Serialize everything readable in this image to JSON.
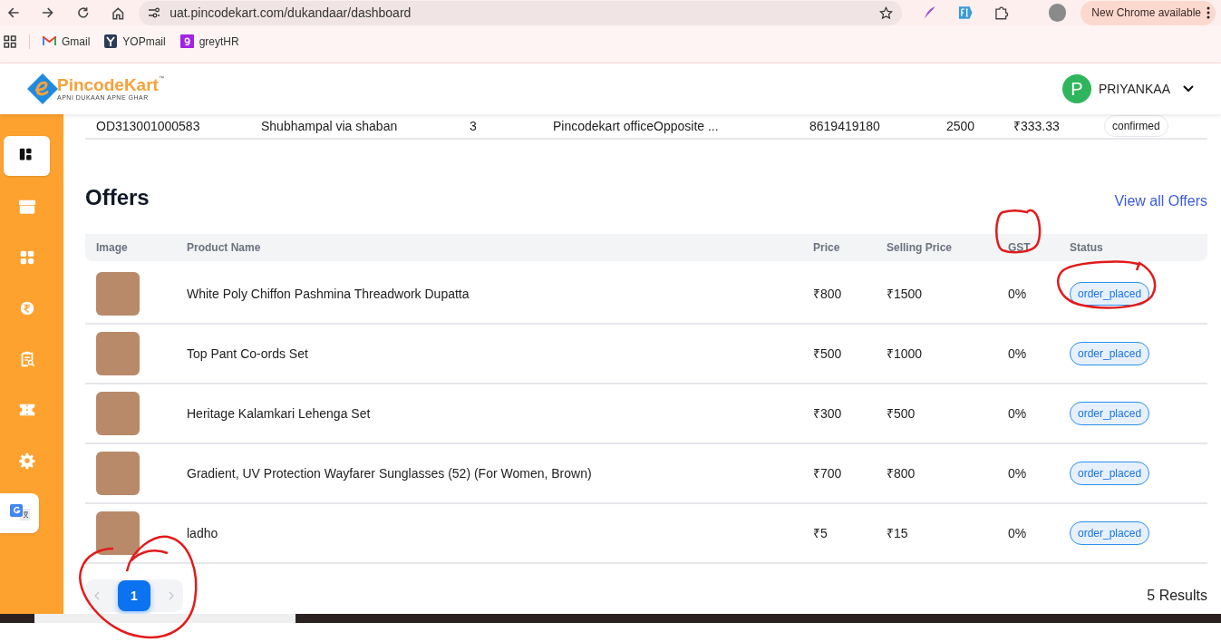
{
  "browser": {
    "url": "uat.pincodekart.com/dukandaar/dashboard",
    "update_label": "New Chrome available",
    "bookmarks": [
      {
        "label": "Gmail",
        "kind": "gmail"
      },
      {
        "label": "YOPmail",
        "kind": "yopmail"
      },
      {
        "label": "greytHR",
        "kind": "greythr"
      }
    ]
  },
  "header": {
    "logo": {
      "name": "PincodeKart",
      "tagline": "APNI DUKAAN APNE GHAR",
      "mark": "™"
    },
    "user": {
      "initial": "P",
      "name": "PRIYANKAA"
    }
  },
  "sidebar": {
    "items": [
      {
        "kind": "dashboard",
        "selected": true
      },
      {
        "kind": "box",
        "selected": false
      },
      {
        "kind": "apps",
        "selected": false
      },
      {
        "kind": "rupee",
        "selected": false
      },
      {
        "kind": "report",
        "selected": false
      },
      {
        "kind": "ticket",
        "selected": false
      },
      {
        "kind": "settings",
        "selected": false
      }
    ]
  },
  "recent_order": {
    "cells": [
      "OD313001000583",
      "Shubhampal via shaban",
      "3",
      "Pincodekart officeOpposite ...",
      "8619419180",
      "2500",
      "₹333.33"
    ],
    "status": "confirmed"
  },
  "offers": {
    "title": "Offers",
    "view_all": "View all Offers",
    "columns": [
      "Image",
      "Product Name",
      "Price",
      "Selling Price",
      "GST",
      "Status"
    ],
    "rows": [
      {
        "product_name": "White Poly Chiffon Pashmina Threadwork Dupatta",
        "price": "₹800",
        "selling_price": "₹1500",
        "gst": "0%",
        "status": "order_placed"
      },
      {
        "product_name": "Top Pant Co-ords Set",
        "price": "₹500",
        "selling_price": "₹1000",
        "gst": "0%",
        "status": "order_placed"
      },
      {
        "product_name": "Heritage Kalamkari Lehenga Set",
        "price": "₹300",
        "selling_price": "₹500",
        "gst": "0%",
        "status": "order_placed"
      },
      {
        "product_name": "Gradient, UV Protection Wayfarer Sunglasses (52) (For Women, Brown)",
        "price": "₹700",
        "selling_price": "₹800",
        "gst": "0%",
        "status": "order_placed"
      },
      {
        "product_name": "ladho",
        "price": "₹5",
        "selling_price": "₹15",
        "gst": "0%",
        "status": "order_placed"
      }
    ],
    "pages": [
      {
        "label": "1",
        "selected": true
      }
    ],
    "results": "5 Results"
  }
}
